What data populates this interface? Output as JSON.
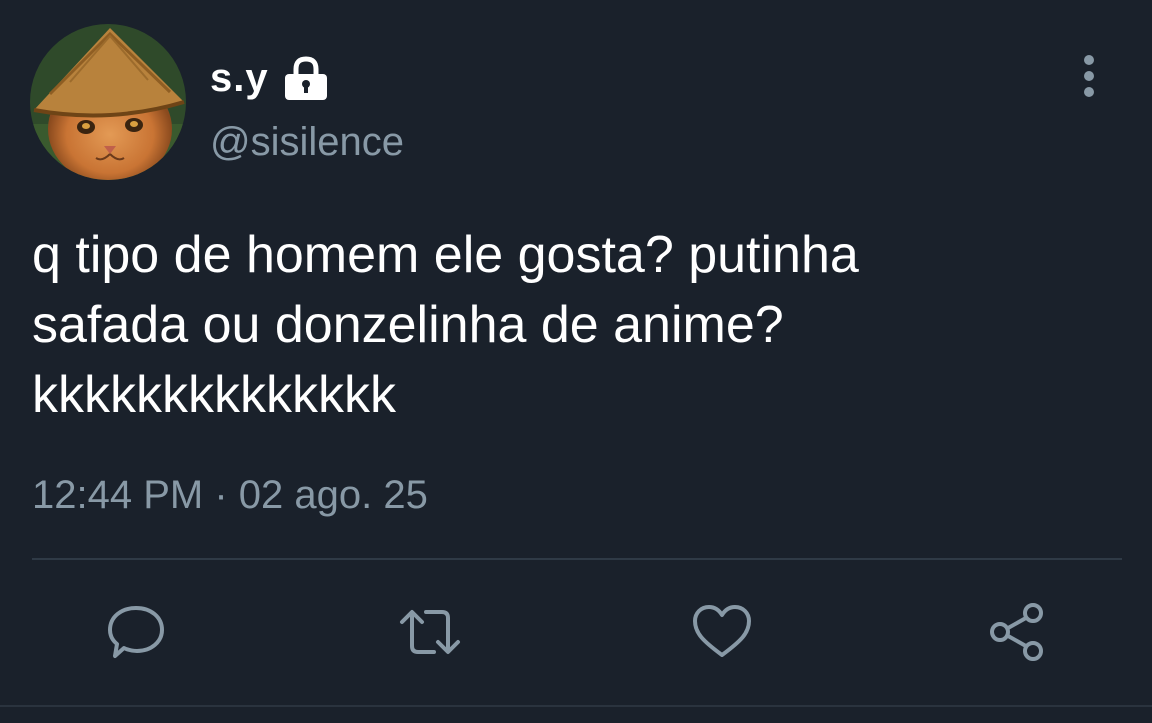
{
  "user": {
    "display_name": "s.y",
    "handle": "@sisilence",
    "protected": true
  },
  "tweet": {
    "text": "q tipo de homem ele gosta? putinha\nsafada ou donzelinha de anime?\nkkkkkkkkkkkkkk",
    "timestamp": "12:44 PM · 02 ago. 25"
  },
  "icons": {
    "avatar": "avatar-cat-straw-hat",
    "lock": "lock-icon",
    "more": "more-vertical-icon",
    "reply": "reply-icon",
    "retweet": "retweet-icon",
    "like": "heart-icon",
    "share": "share-icon"
  },
  "colors": {
    "background": "#1a212b",
    "primary_text": "#ffffff",
    "secondary_text": "#8899a6",
    "divider": "#2f3a46"
  }
}
